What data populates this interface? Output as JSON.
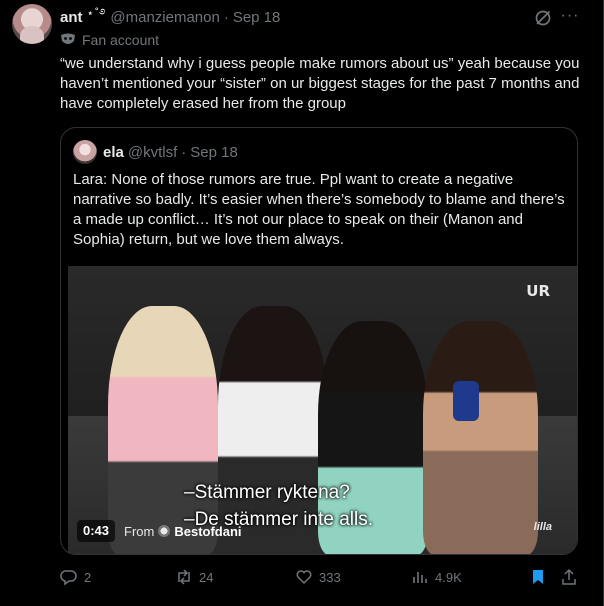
{
  "tweet": {
    "author_name": "ant",
    "author_deco": "⋆˚࿔",
    "handle": "@manziemanon",
    "separator": "·",
    "date": "Sep 18",
    "fan_label": "Fan account",
    "text": "“we understand why i guess people make rumors about us” yeah because you haven’t mentioned your “sister” on ur biggest stages for the past 7 months and have completely erased her from the group"
  },
  "quote": {
    "author_name": "ela",
    "handle": "@kvtlsf",
    "separator": "·",
    "date": "Sep 18",
    "text": "Lara: None of those rumors are true. Ppl want to create a negative narrative so badly. It’s easier when there’s somebody to blame and there’s a made up conflict… It’s not our place to speak on their (Manon and Sophia) return, but we love them always.",
    "video": {
      "channel_logo": "UR",
      "corner_logo": "lilla",
      "subtitle_line1": "–Stämmer ryktena?",
      "subtitle_line2": "–De stämmer inte alls.",
      "timer": "0:43",
      "from_label": "From",
      "from_name": "Bestofdani"
    }
  },
  "actions": {
    "replies": "2",
    "retweets": "24",
    "likes": "333",
    "views": "4.9K"
  },
  "colors": {
    "background": "#000000",
    "text": "#e7e9ea",
    "muted": "#71767b",
    "border": "#2f3336",
    "accent": "#1d9bf0"
  }
}
